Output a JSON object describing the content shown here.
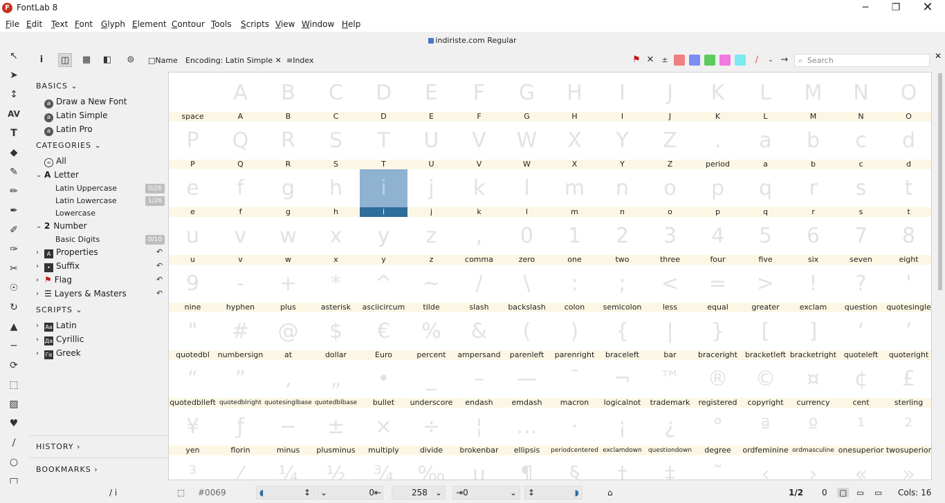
{
  "window": {
    "title": "FontLab 8",
    "icon_letter": "F"
  },
  "menu": [
    "File",
    "Edit",
    "Text",
    "Font",
    "Glyph",
    "Element",
    "Contour",
    "Tools",
    "Scripts",
    "View",
    "Window",
    "Help"
  ],
  "document": {
    "name": "indiriste.com Regular"
  },
  "topbar": {
    "name_label": "Name",
    "encoding_label": "Encoding: Latin Simple",
    "index_label": "Index",
    "search_placeholder": "Search"
  },
  "swatches": [
    "#f08080",
    "#7b8ef0",
    "#5ccc5c",
    "#f078e0",
    "#7ce8f0"
  ],
  "sidebar": {
    "basics_label": "BASICS",
    "basics": [
      "Draw a New Font",
      "Latin Simple",
      "Latin Pro"
    ],
    "categories_label": "CATEGORIES",
    "all_label": "All",
    "letter_label": "Letter",
    "letter_subs": [
      {
        "label": "Latin Uppercase",
        "count": "0/26"
      },
      {
        "label": "Latin Lowercase",
        "count": "1/26"
      },
      {
        "label": "Lowercase",
        "count": ""
      }
    ],
    "number_label": "Number",
    "number_subs": [
      {
        "label": "Basic Digits",
        "count": "0/10"
      }
    ],
    "groups": [
      "Properties",
      "Suffix",
      "Flag",
      "Layers & Masters"
    ],
    "scripts_label": "SCRIPTS",
    "scripts": [
      {
        "label": "Latin",
        "icon": "Aa"
      },
      {
        "label": "Cyrillic",
        "icon": "Да"
      },
      {
        "label": "Greek",
        "icon": "Γα"
      }
    ],
    "history_label": "HISTORY",
    "bookmarks_label": "BOOKMARKS"
  },
  "glyphs": [
    {
      "g": " ",
      "n": "space"
    },
    {
      "g": "A",
      "n": "A"
    },
    {
      "g": "B",
      "n": "B"
    },
    {
      "g": "C",
      "n": "C"
    },
    {
      "g": "D",
      "n": "D"
    },
    {
      "g": "E",
      "n": "E"
    },
    {
      "g": "F",
      "n": "F"
    },
    {
      "g": "G",
      "n": "G"
    },
    {
      "g": "H",
      "n": "H"
    },
    {
      "g": "I",
      "n": "I"
    },
    {
      "g": "J",
      "n": "J"
    },
    {
      "g": "K",
      "n": "K"
    },
    {
      "g": "L",
      "n": "L"
    },
    {
      "g": "M",
      "n": "M"
    },
    {
      "g": "N",
      "n": "N"
    },
    {
      "g": "O",
      "n": "O"
    },
    {
      "g": "P",
      "n": "P"
    },
    {
      "g": "Q",
      "n": "Q"
    },
    {
      "g": "R",
      "n": "R"
    },
    {
      "g": "S",
      "n": "S"
    },
    {
      "g": "T",
      "n": "T"
    },
    {
      "g": "U",
      "n": "U"
    },
    {
      "g": "V",
      "n": "V"
    },
    {
      "g": "W",
      "n": "W"
    },
    {
      "g": "X",
      "n": "X"
    },
    {
      "g": "Y",
      "n": "Y"
    },
    {
      "g": "Z",
      "n": "Z"
    },
    {
      "g": ".",
      "n": "period"
    },
    {
      "g": "a",
      "n": "a"
    },
    {
      "g": "b",
      "n": "b"
    },
    {
      "g": "c",
      "n": "c"
    },
    {
      "g": "d",
      "n": "d"
    },
    {
      "g": "e",
      "n": "e"
    },
    {
      "g": "f",
      "n": "f"
    },
    {
      "g": "g",
      "n": "g"
    },
    {
      "g": "h",
      "n": "h"
    },
    {
      "g": "i",
      "n": "i",
      "sel": true
    },
    {
      "g": "j",
      "n": "j"
    },
    {
      "g": "k",
      "n": "k"
    },
    {
      "g": "l",
      "n": "l"
    },
    {
      "g": "m",
      "n": "m"
    },
    {
      "g": "n",
      "n": "n"
    },
    {
      "g": "o",
      "n": "o"
    },
    {
      "g": "p",
      "n": "p"
    },
    {
      "g": "q",
      "n": "q"
    },
    {
      "g": "r",
      "n": "r"
    },
    {
      "g": "s",
      "n": "s"
    },
    {
      "g": "t",
      "n": "t"
    },
    {
      "g": "u",
      "n": "u"
    },
    {
      "g": "v",
      "n": "v"
    },
    {
      "g": "w",
      "n": "w"
    },
    {
      "g": "x",
      "n": "x"
    },
    {
      "g": "y",
      "n": "y"
    },
    {
      "g": "z",
      "n": "z"
    },
    {
      "g": ",",
      "n": "comma"
    },
    {
      "g": "0",
      "n": "zero"
    },
    {
      "g": "1",
      "n": "one"
    },
    {
      "g": "2",
      "n": "two"
    },
    {
      "g": "3",
      "n": "three"
    },
    {
      "g": "4",
      "n": "four"
    },
    {
      "g": "5",
      "n": "five"
    },
    {
      "g": "6",
      "n": "six"
    },
    {
      "g": "7",
      "n": "seven"
    },
    {
      "g": "8",
      "n": "eight"
    },
    {
      "g": "9",
      "n": "nine"
    },
    {
      "g": "-",
      "n": "hyphen"
    },
    {
      "g": "+",
      "n": "plus"
    },
    {
      "g": "*",
      "n": "asterisk"
    },
    {
      "g": "^",
      "n": "asciicircum"
    },
    {
      "g": "~",
      "n": "tilde"
    },
    {
      "g": "/",
      "n": "slash"
    },
    {
      "g": "\\",
      "n": "backslash"
    },
    {
      "g": ":",
      "n": "colon"
    },
    {
      "g": ";",
      "n": "semicolon"
    },
    {
      "g": "<",
      "n": "less"
    },
    {
      "g": "=",
      "n": "equal"
    },
    {
      "g": ">",
      "n": "greater"
    },
    {
      "g": "!",
      "n": "exclam"
    },
    {
      "g": "?",
      "n": "question"
    },
    {
      "g": "'",
      "n": "quotesingle"
    },
    {
      "g": "\"",
      "n": "quotedbl"
    },
    {
      "g": "#",
      "n": "numbersign"
    },
    {
      "g": "@",
      "n": "at"
    },
    {
      "g": "$",
      "n": "dollar"
    },
    {
      "g": "€",
      "n": "Euro"
    },
    {
      "g": "%",
      "n": "percent"
    },
    {
      "g": "&",
      "n": "ampersand"
    },
    {
      "g": "(",
      "n": "parenleft"
    },
    {
      "g": ")",
      "n": "parenright"
    },
    {
      "g": "{",
      "n": "braceleft"
    },
    {
      "g": "|",
      "n": "bar"
    },
    {
      "g": "}",
      "n": "braceright"
    },
    {
      "g": "[",
      "n": "bracketleft"
    },
    {
      "g": "]",
      "n": "bracketright"
    },
    {
      "g": "‘",
      "n": "quoteleft"
    },
    {
      "g": "’",
      "n": "quoteright"
    },
    {
      "g": "“",
      "n": "quotedblleft"
    },
    {
      "g": "”",
      "n": "quotedblright",
      "s": true
    },
    {
      "g": "‚",
      "n": "quotesinglbase",
      "s": true
    },
    {
      "g": "„",
      "n": "quotedblbase",
      "s": true
    },
    {
      "g": "•",
      "n": "bullet"
    },
    {
      "g": "_",
      "n": "underscore"
    },
    {
      "g": "–",
      "n": "endash"
    },
    {
      "g": "—",
      "n": "emdash"
    },
    {
      "g": "¯",
      "n": "macron"
    },
    {
      "g": "¬",
      "n": "logicalnot"
    },
    {
      "g": "™",
      "n": "trademark"
    },
    {
      "g": "®",
      "n": "registered"
    },
    {
      "g": "©",
      "n": "copyright"
    },
    {
      "g": "¤",
      "n": "currency"
    },
    {
      "g": "¢",
      "n": "cent"
    },
    {
      "g": "£",
      "n": "sterling"
    },
    {
      "g": "¥",
      "n": "yen"
    },
    {
      "g": "ƒ",
      "n": "florin"
    },
    {
      "g": "−",
      "n": "minus"
    },
    {
      "g": "±",
      "n": "plusminus"
    },
    {
      "g": "×",
      "n": "multiply"
    },
    {
      "g": "÷",
      "n": "divide"
    },
    {
      "g": "¦",
      "n": "brokenbar"
    },
    {
      "g": "…",
      "n": "ellipsis"
    },
    {
      "g": "·",
      "n": "periodcentered",
      "s": true
    },
    {
      "g": "¡",
      "n": "exclamdown",
      "s": true
    },
    {
      "g": "¿",
      "n": "questiondown",
      "s": true
    },
    {
      "g": "°",
      "n": "degree"
    },
    {
      "g": "ª",
      "n": "ordfeminine"
    },
    {
      "g": "º",
      "n": "ordmasculine",
      "s": true
    },
    {
      "g": "¹",
      "n": "onesuperior"
    },
    {
      "g": "²",
      "n": "twosuperior"
    },
    {
      "g": "³",
      "n": ""
    },
    {
      "g": "⁄",
      "n": ""
    },
    {
      "g": "¼",
      "n": ""
    },
    {
      "g": "½",
      "n": ""
    },
    {
      "g": "¾",
      "n": ""
    },
    {
      "g": "‰",
      "n": ""
    },
    {
      "g": "µ",
      "n": ""
    },
    {
      "g": "¶",
      "n": ""
    },
    {
      "g": "§",
      "n": ""
    },
    {
      "g": "†",
      "n": ""
    },
    {
      "g": "‡",
      "n": ""
    },
    {
      "g": "˜",
      "n": ""
    },
    {
      "g": "‹",
      "n": ""
    },
    {
      "g": "›",
      "n": ""
    },
    {
      "g": "«",
      "n": ""
    },
    {
      "g": "»",
      "n": ""
    }
  ],
  "status": {
    "current_glyph": "/ i",
    "unicode": "#0069",
    "field_zero": "0",
    "font_size": "258",
    "right_value": "0",
    "page": "1/2",
    "right_zero": "0",
    "cols": "Cols: 16"
  }
}
